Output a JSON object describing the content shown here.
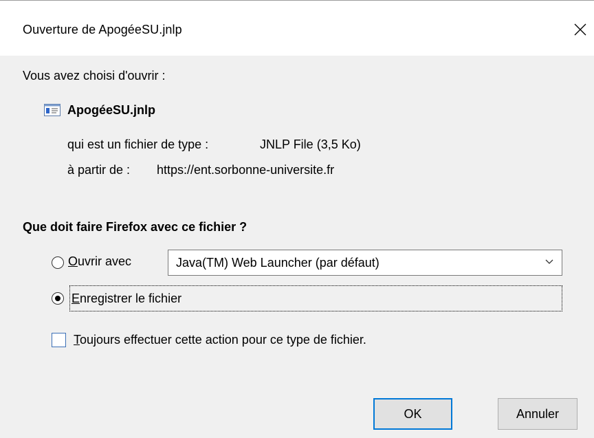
{
  "dialog": {
    "title": "Ouverture de ApogéeSU.jnlp",
    "intro": "Vous avez choisi d'ouvrir :",
    "file_name": "ApogéeSU.jnlp",
    "type_label": "qui est un fichier de type :",
    "type_value": "JNLP File (3,5 Ko)",
    "from_label": "à partir de :",
    "from_value": "https://ent.sorbonne-universite.fr"
  },
  "question": "Que doit faire Firefox avec ce fichier ?",
  "open_with": {
    "label_first": "O",
    "label_rest": "uvrir avec",
    "selected": false,
    "app_value": "Java(TM) Web Launcher (par défaut)"
  },
  "save_file": {
    "label_first": "E",
    "label_rest": "nregistrer le fichier",
    "selected": true
  },
  "always_checkbox": {
    "label_first": "T",
    "label_rest": "oujours effectuer cette action pour ce type de fichier.",
    "checked": false
  },
  "buttons": {
    "ok": "OK",
    "cancel": "Annuler"
  },
  "colors": {
    "accent": "#0078d7",
    "dialog_bg": "#f0f0f0"
  }
}
